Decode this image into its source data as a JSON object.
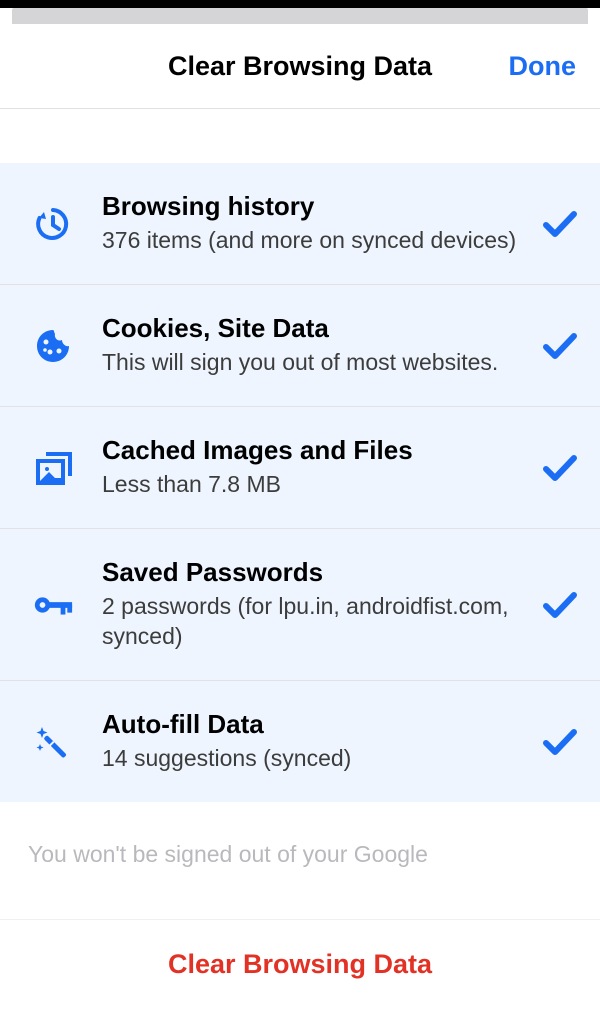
{
  "header": {
    "title": "Clear Browsing Data",
    "done": "Done"
  },
  "items": [
    {
      "icon": "history",
      "title": "Browsing history",
      "subtitle": "376 items (and more on synced devices)"
    },
    {
      "icon": "cookie",
      "title": "Cookies, Site Data",
      "subtitle": "This will sign you out of most websites."
    },
    {
      "icon": "images",
      "title": "Cached Images and Files",
      "subtitle": "Less than 7.8 MB"
    },
    {
      "icon": "key",
      "title": "Saved Passwords",
      "subtitle": "2 passwords (for lpu.in, androidfist.com, synced)"
    },
    {
      "icon": "wand",
      "title": "Auto-fill Data",
      "subtitle": "14 suggestions (synced)"
    }
  ],
  "footer_info": "You won't be signed out of your Google",
  "bottom": {
    "clear": "Clear Browsing Data"
  },
  "accent_color": "#1b6ef3",
  "destructive_color": "#e23226"
}
